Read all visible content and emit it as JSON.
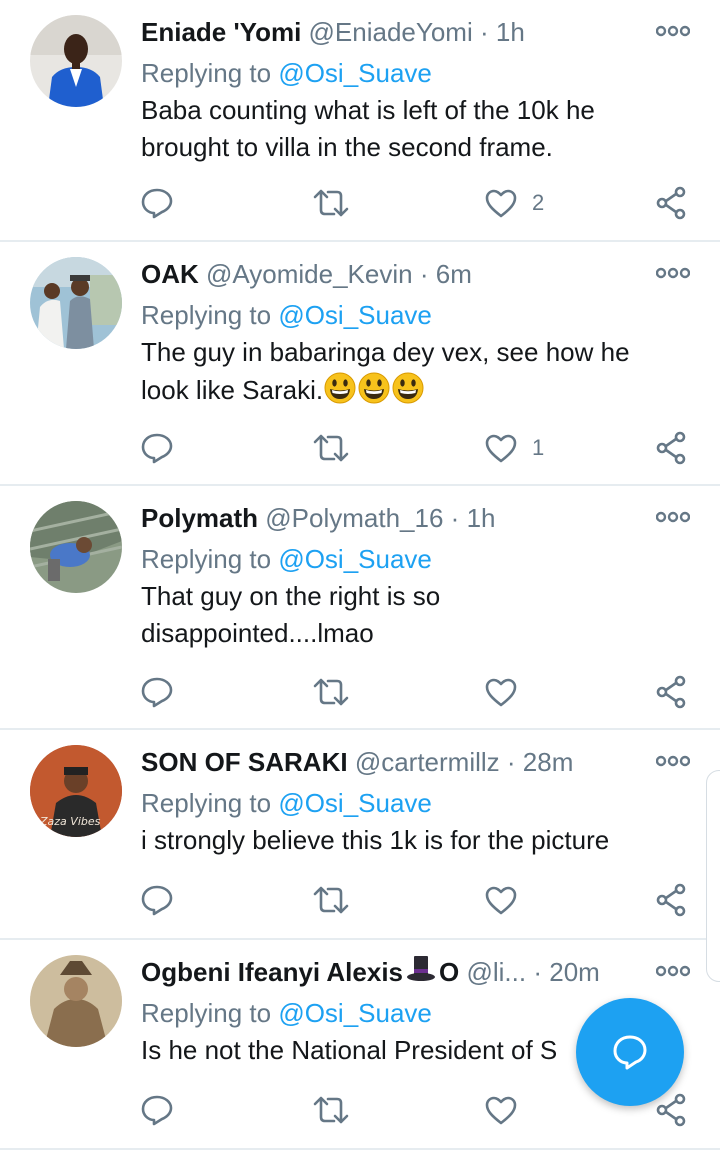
{
  "tweets": [
    {
      "name": "Eniade 'Yomi",
      "handle": "@EniadeYomi",
      "dot": "·",
      "time": "1h",
      "replying_prefix": "Replying to ",
      "replying_to": "@Osi_Suave",
      "text_lines": [
        "Baba counting what is left of the 10k he",
        "brought to villa in the second frame."
      ],
      "likes": "2"
    },
    {
      "name": "OAK",
      "handle": "@Ayomide_Kevin",
      "dot": "·",
      "time": "6m",
      "replying_prefix": "Replying to ",
      "replying_to": "@Osi_Suave",
      "text_lines": [
        "The guy in babaringa dey vex, see how he",
        "look like Saraki."
      ],
      "emojis": [
        "grinning-face",
        "grinning-face",
        "grinning-face"
      ],
      "likes": "1"
    },
    {
      "name": "Polymath",
      "handle": "@Polymath_16",
      "dot": "·",
      "time": "1h",
      "replying_prefix": "Replying to ",
      "replying_to": "@Osi_Suave",
      "text_lines": [
        "That guy on the right is so",
        "disappointed....lmao"
      ],
      "likes": ""
    },
    {
      "name": "SON OF SARAKI",
      "handle": "@cartermillz",
      "dot": "·",
      "time": "28m",
      "replying_prefix": "Replying to ",
      "replying_to": "@Osi_Suave",
      "text_lines": [
        "i strongly believe this 1k is for the picture"
      ],
      "likes": ""
    },
    {
      "name": "Ogbeni Ifeanyi Alexis",
      "name_suffix": "O",
      "name_emoji": "top-hat",
      "handle": "@li...",
      "dot": "·",
      "time": "20m",
      "replying_prefix": "Replying to ",
      "replying_to": "@Osi_Suave",
      "text_lines": [
        "Is he not the National President of S"
      ],
      "likes": ""
    }
  ],
  "icons": {
    "more": "more-options-icon",
    "reply": "reply-icon",
    "retweet": "retweet-icon",
    "like": "heart-icon",
    "share": "share-icon",
    "compose": "compose-reply-icon"
  },
  "colors": {
    "accent": "#1da1f2",
    "muted": "#657786",
    "text": "#14171a",
    "divider": "#e6ecf0"
  }
}
